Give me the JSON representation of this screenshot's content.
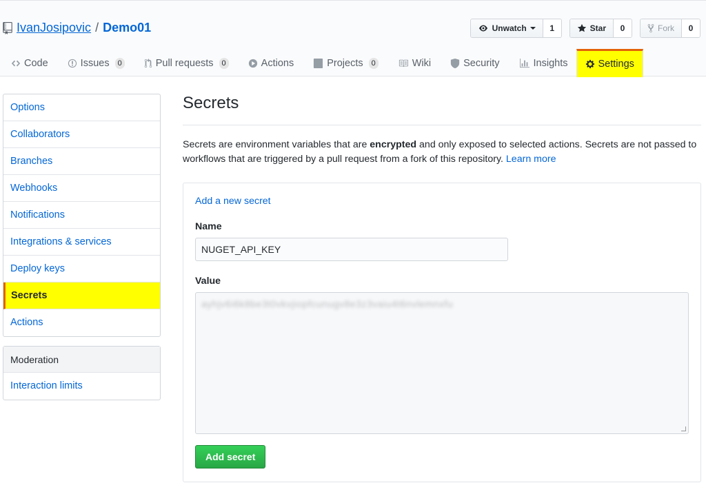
{
  "repo": {
    "owner": "IvanJosipovic",
    "separator": "/",
    "name": "Demo01"
  },
  "actions": {
    "watch": {
      "label": "Unwatch",
      "count": "1"
    },
    "star": {
      "label": "Star",
      "count": "0"
    },
    "fork": {
      "label": "Fork",
      "count": "0"
    }
  },
  "tabs": [
    {
      "label": "Code",
      "icon": "code-icon"
    },
    {
      "label": "Issues",
      "icon": "issue-icon",
      "counter": "0"
    },
    {
      "label": "Pull requests",
      "icon": "pull-request-icon",
      "counter": "0"
    },
    {
      "label": "Actions",
      "icon": "play-icon"
    },
    {
      "label": "Projects",
      "icon": "project-icon",
      "counter": "0"
    },
    {
      "label": "Wiki",
      "icon": "book-icon"
    },
    {
      "label": "Security",
      "icon": "shield-icon"
    },
    {
      "label": "Insights",
      "icon": "graph-icon"
    },
    {
      "label": "Settings",
      "icon": "gear-icon",
      "selected": true
    }
  ],
  "sidebar": {
    "items": [
      "Options",
      "Collaborators",
      "Branches",
      "Webhooks",
      "Notifications",
      "Integrations & services",
      "Deploy keys",
      "Secrets",
      "Actions"
    ],
    "selected": "Secrets",
    "moderation_heading": "Moderation",
    "moderation_items": [
      "Interaction limits"
    ]
  },
  "main": {
    "title": "Secrets",
    "description_part1": "Secrets are environment variables that are ",
    "description_bold": "encrypted",
    "description_part2": " and only exposed to selected actions. Secrets are not passed to workflows that are triggered by a pull request from a fork of this repository. ",
    "learn_more": "Learn more",
    "add_link": "Add a new secret",
    "name_label": "Name",
    "name_value": "NUGET_API_KEY",
    "value_label": "Value",
    "value_blurred": "ayhjv6i6k8be3t0vkvjiopfcunugv8e3z3vaiu4t6nvlemnxfu",
    "submit": "Add secret"
  },
  "colors": {
    "highlight": "#ffff00",
    "link": "#0366d6",
    "primary": "#28a745"
  }
}
